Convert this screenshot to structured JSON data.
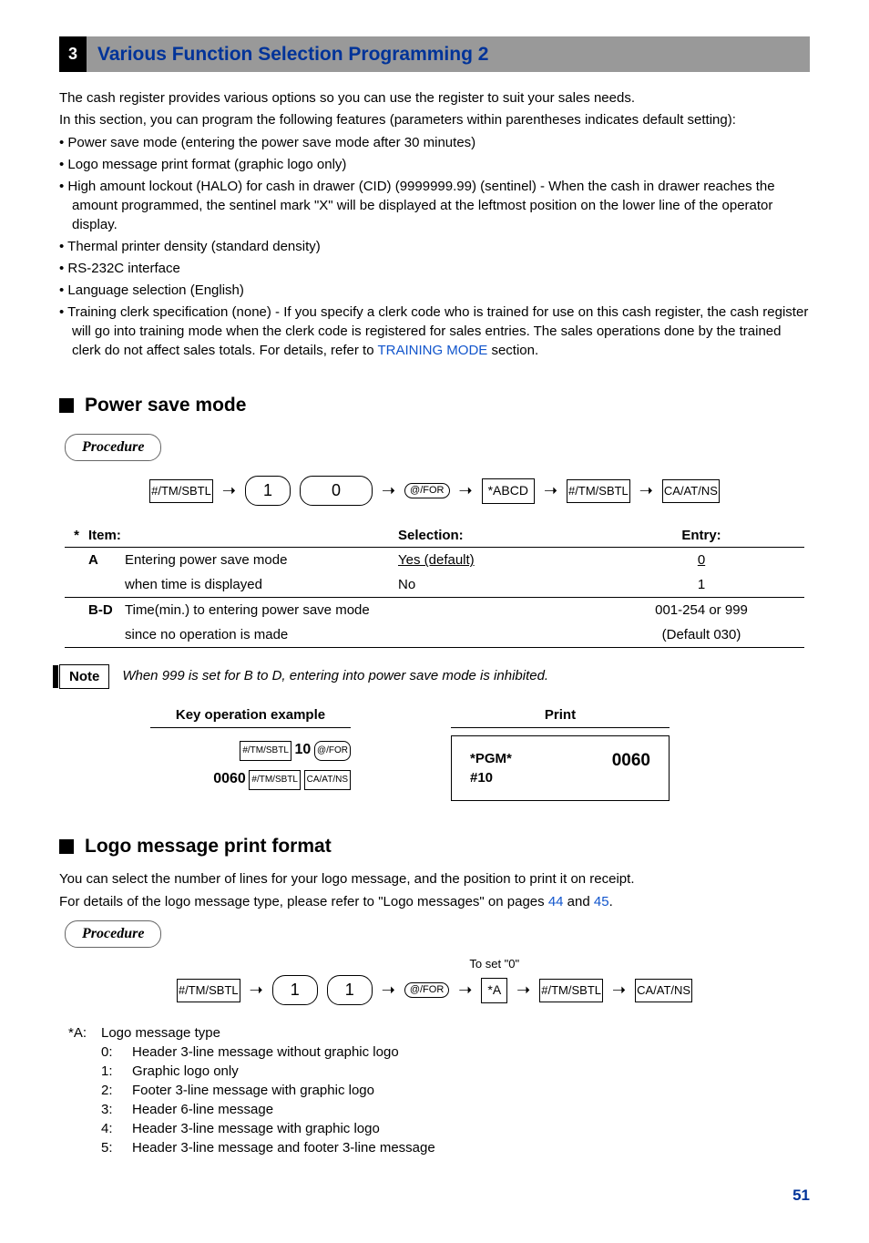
{
  "section": {
    "number": "3",
    "title": "Various Function Selection Programming 2"
  },
  "intro": {
    "p1": "The cash register provides various options so you can use the register to suit your sales needs.",
    "p2": "In this section, you can program the following features (parameters within parentheses indicates default setting):",
    "bullets": [
      "Power save mode (entering the power save mode after 30 minutes)",
      "Logo message print format (graphic logo only)",
      "High amount lockout (HALO) for cash in drawer (CID) (9999999.99) (sentinel) - When the cash in drawer reaches the amount programmed, the sentinel mark \"X\" will be displayed at the leftmost position on the lower line of the operator display.",
      "Thermal printer density (standard density)",
      "RS-232C interface",
      "Language selection (English)"
    ],
    "training_pre": "Training clerk specification (none) - If you specify a clerk code who is trained for use on this cash register, the cash register will go into training mode when the clerk code is registered for sales entries. The sales operations done by the trained clerk do not affect sales totals. For details, refer to ",
    "training_link": "TRAINING MODE",
    "training_post": " section."
  },
  "power_save": {
    "heading": "Power save mode",
    "procedure": "Procedure",
    "keys": {
      "tm": "#/TM/SBTL",
      "d1": "1",
      "d0": "0",
      "for": "@/FOR",
      "abcd": "*ABCD",
      "caat": "CA/AT/NS"
    },
    "table": {
      "star": "*",
      "h_item": "Item:",
      "h_sel": "Selection:",
      "h_ent": "Entry:",
      "rows": [
        {
          "item": "A",
          "desc": "Entering power save mode",
          "sel": "Yes (default)",
          "ent": "0"
        },
        {
          "item": "",
          "desc": "when time is displayed",
          "sel": "No",
          "ent": "1"
        },
        {
          "item": "B-D",
          "desc": "Time(min.) to entering power save mode",
          "sel": "",
          "ent": "001-254 or 999"
        },
        {
          "item": "",
          "desc": "since no operation is made",
          "sel": "",
          "ent": "(Default 030)"
        }
      ]
    },
    "note_label": "Note",
    "note_text": "When 999 is set for B to D, entering into power save mode is inhibited.",
    "example": {
      "key_hdr": "Key operation example",
      "print_hdr": "Print",
      "line1_pre": "#/TM/SBTL",
      "line1_num": "10",
      "line1_for": "@/FOR",
      "line2_num": "0060",
      "line2_tm": "#/TM/SBTL",
      "line2_ca": "CA/AT/NS",
      "print_left": "*PGM*\n#10",
      "print_right": "0060"
    }
  },
  "logo": {
    "heading": "Logo message print format",
    "p1": "You can select the number of lines for your logo message, and the position to print it on receipt.",
    "p2a": "For details of the logo message type, please refer to \"Logo messages\" on pages ",
    "link44": "44",
    "and": " and ",
    "link45": "45",
    "p2b": ".",
    "procedure": "Procedure",
    "to_set": "To set \"0\"",
    "keys": {
      "tm": "#/TM/SBTL",
      "d1a": "1",
      "d1b": "1",
      "for": "@/FOR",
      "a": "*A",
      "caat": "CA/AT/NS"
    },
    "list_header_a": "*A:",
    "list_header_b": "Logo message type",
    "list": [
      {
        "n": "0:",
        "t": "Header 3-line message without graphic logo"
      },
      {
        "n": "1:",
        "t": "Graphic logo only"
      },
      {
        "n": "2:",
        "t": "Footer 3-line message with graphic logo"
      },
      {
        "n": "3:",
        "t": "Header 6-line message"
      },
      {
        "n": "4:",
        "t": "Header 3-line message with graphic logo"
      },
      {
        "n": "5:",
        "t": "Header 3-line message and footer 3-line message"
      }
    ]
  },
  "page_number": "51"
}
